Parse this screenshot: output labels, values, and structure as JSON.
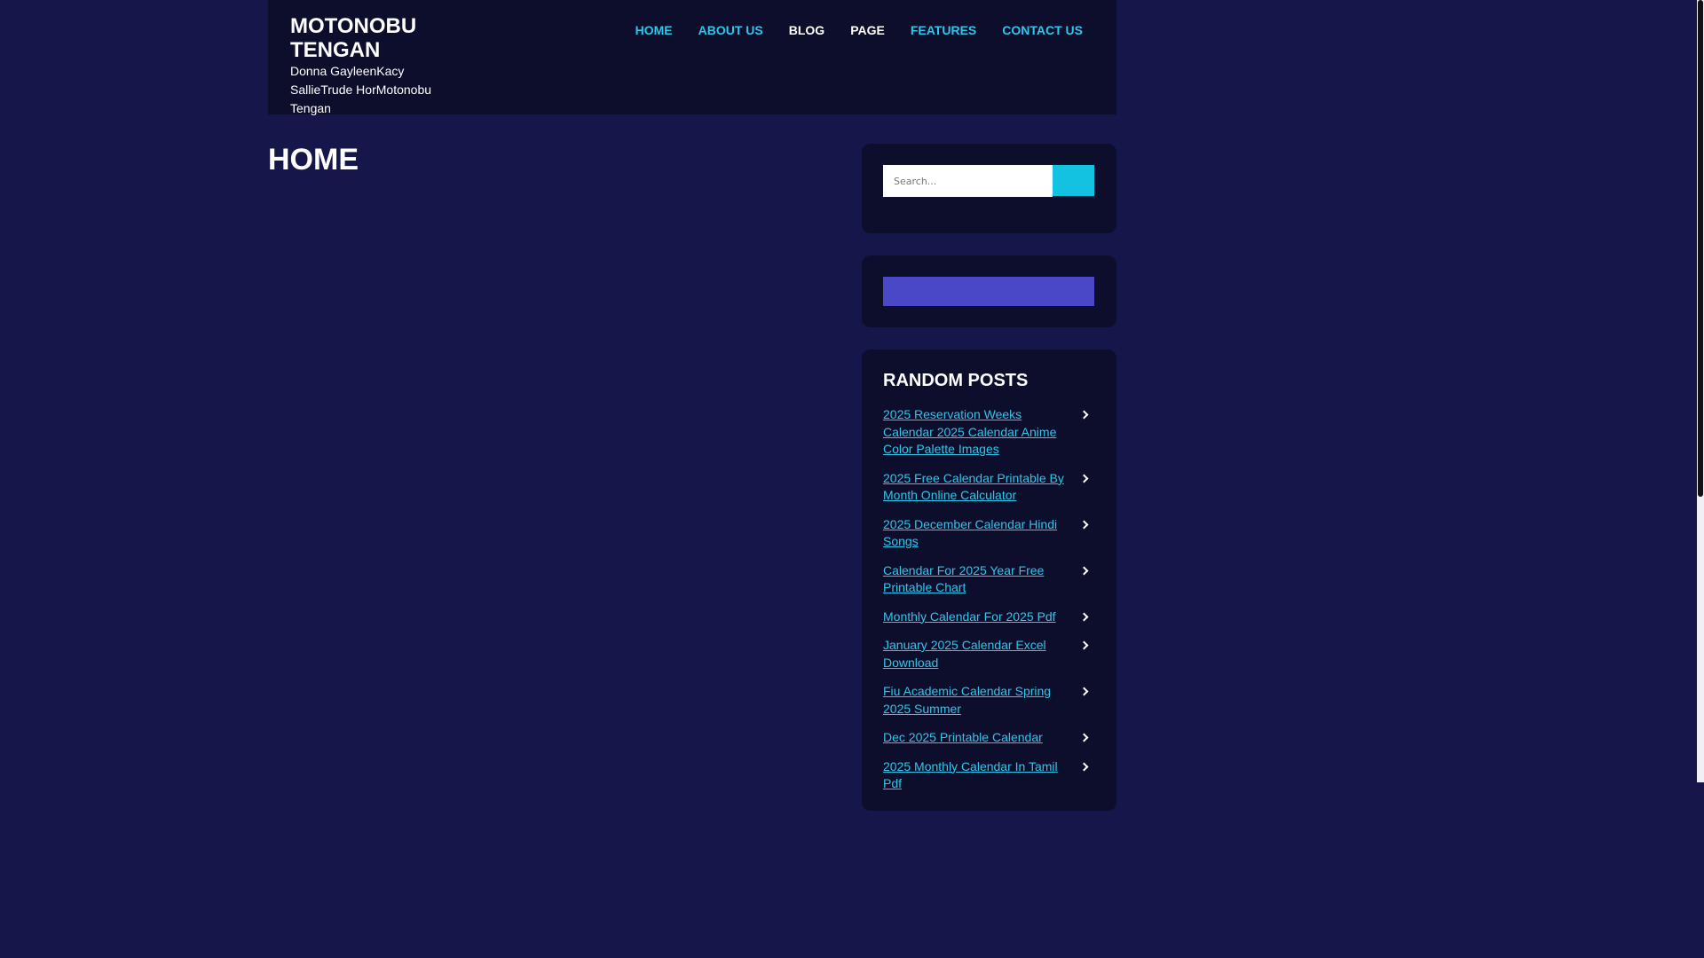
{
  "site": {
    "title": "MOTONOBU TENGAN",
    "tagline": "Donna GayleenKacy SallieTrude HorMotonobu Tengan"
  },
  "nav": {
    "items": [
      {
        "label": "HOME",
        "color": "#2ec6ea"
      },
      {
        "label": "ABOUT US",
        "color": "#2ec6ea"
      },
      {
        "label": "BLOG",
        "color": "#ffffff"
      },
      {
        "label": "PAGE",
        "color": "#ffffff"
      },
      {
        "label": "FEATURES",
        "color": "#2ec6ea"
      },
      {
        "label": "CONTACT US",
        "color": "#2ec6ea"
      }
    ]
  },
  "main": {
    "heading": "HOME"
  },
  "search": {
    "placeholder": "Search..."
  },
  "random_posts": {
    "title": "RANDOM POSTS",
    "items": [
      {
        "label": "2025 Reservation Weeks Calendar 2025 Calendar Anime Color Palette Images"
      },
      {
        "label": "2025 Free Calendar Printable By Month Online Calculator"
      },
      {
        "label": "2025 December Calendar Hindi Songs"
      },
      {
        "label": "Calendar For 2025 Year Free Printable Chart"
      },
      {
        "label": "Monthly Calendar For 2025 Pdf"
      },
      {
        "label": "January 2025 Calendar Excel Download"
      },
      {
        "label": "Fiu Academic Calendar Spring 2025 Summer"
      },
      {
        "label": "Dec 2025 Printable Calendar"
      },
      {
        "label": "2025 Monthly Calendar In Tamil Pdf"
      }
    ]
  },
  "colors": {
    "page_background": "#15164a",
    "panel_background": "#0d0e2b",
    "accent": "#12c2e0",
    "link": "#2ec6ea",
    "banner": "#4a48c7"
  }
}
